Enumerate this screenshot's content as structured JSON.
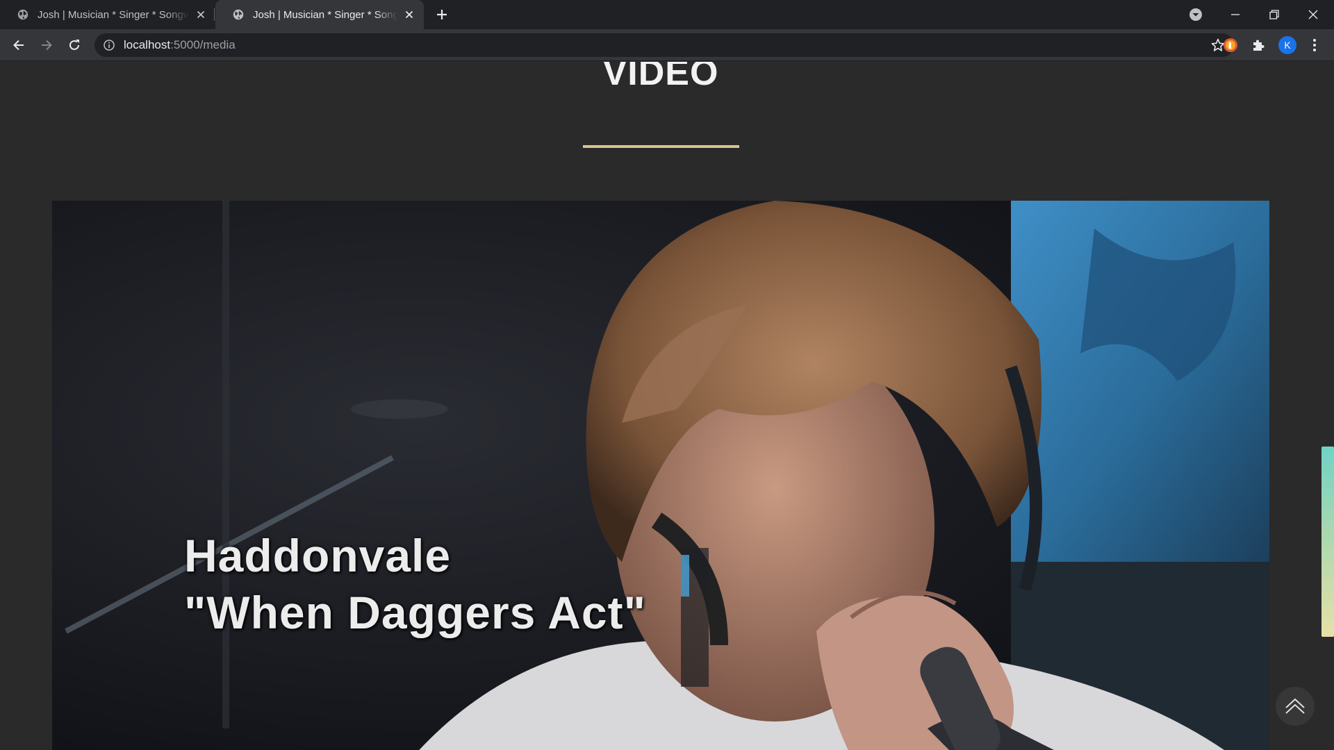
{
  "browser": {
    "tabs": [
      {
        "title": "Josh | Musician * Singer * Songwriter",
        "active": false
      },
      {
        "title": "Josh | Musician * Singer * Songwriter",
        "active": true
      }
    ],
    "address": {
      "host": "localhost",
      "path": ":5000/media"
    },
    "profile_initial": "K",
    "icons": {
      "tab": "globe-icon",
      "close": "close-icon",
      "new_tab": "plus-icon",
      "back": "arrow-left-icon",
      "forward": "arrow-right-icon",
      "reload": "reload-icon",
      "info": "info-icon",
      "bookmark": "star-icon",
      "extensions": "puzzle-icon"
    }
  },
  "page": {
    "section_heading": "VIDEO",
    "accent_color": "#d8c58a",
    "video": {
      "caption_line1": "Haddonvale",
      "caption_line2": "\"When Daggers Act\""
    },
    "back_to_top_icon": "double-chevron-up-icon"
  }
}
